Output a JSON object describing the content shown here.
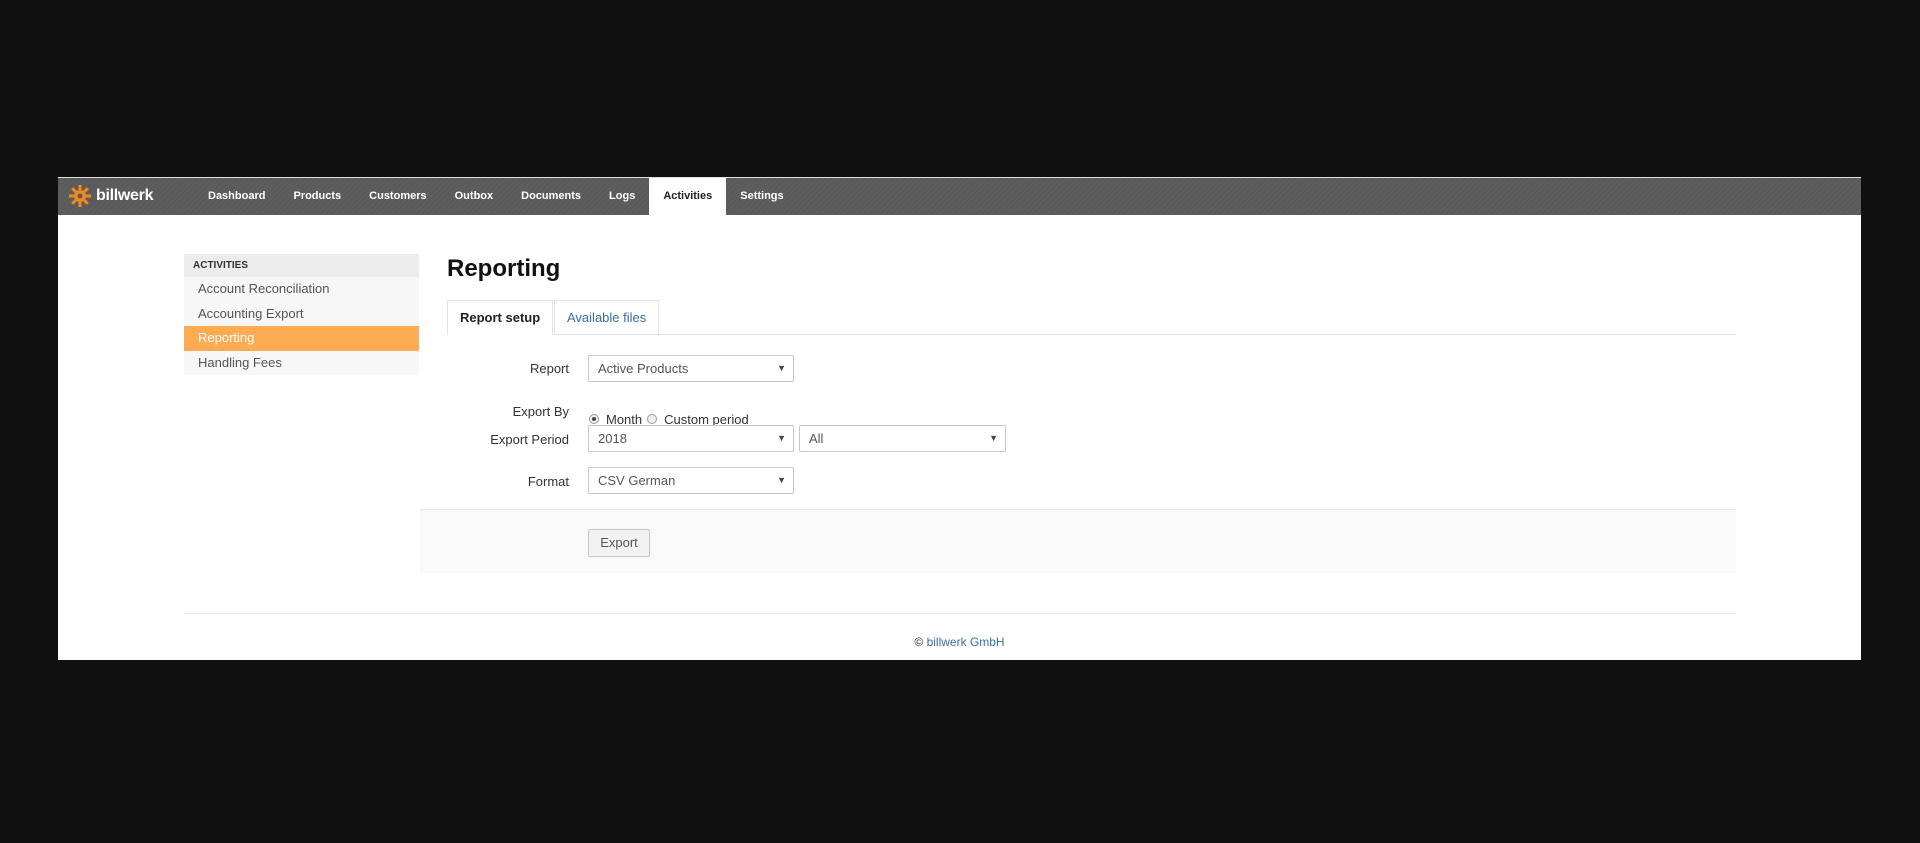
{
  "app": {
    "brand": "billwerk",
    "colors": {
      "accent": "#fdab52",
      "topbar": "#5a5a5a",
      "link": "#3b6fa8"
    }
  },
  "nav": {
    "items": [
      {
        "label": "Dashboard"
      },
      {
        "label": "Products"
      },
      {
        "label": "Customers"
      },
      {
        "label": "Outbox"
      },
      {
        "label": "Documents"
      },
      {
        "label": "Logs"
      },
      {
        "label": "Activities",
        "active": true
      },
      {
        "label": "Settings"
      }
    ]
  },
  "sidebar": {
    "heading": "ACTIVITIES",
    "items": [
      {
        "label": "Account Reconciliation"
      },
      {
        "label": "Accounting Export"
      },
      {
        "label": "Reporting",
        "active": true
      },
      {
        "label": "Handling Fees"
      }
    ]
  },
  "main": {
    "title": "Reporting",
    "tabs": [
      {
        "label": "Report setup",
        "active": true
      },
      {
        "label": "Available files"
      }
    ],
    "form": {
      "report_label": "Report",
      "report_value": "Active Products",
      "export_by_label": "Export By",
      "export_by_options": [
        "Month",
        "Custom period"
      ],
      "export_by_selected": "Month",
      "export_period_label": "Export Period",
      "period_year": "2018",
      "period_month": "All",
      "format_label": "Format",
      "format_value": "CSV German"
    },
    "export_button": "Export"
  },
  "footer": {
    "copyright_symbol": "©",
    "company": "billwerk GmbH"
  }
}
